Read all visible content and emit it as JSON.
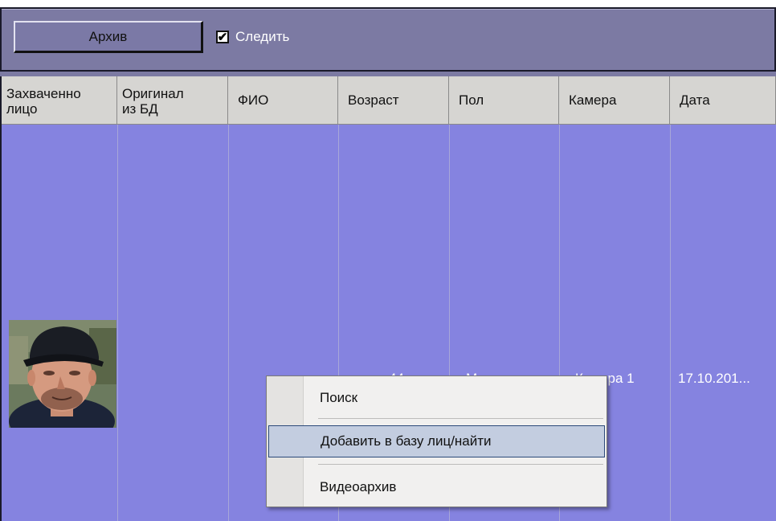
{
  "toolbar": {
    "archive_label": "Архив",
    "follow_label": "Следить",
    "follow_checked": true
  },
  "table": {
    "columns": [
      {
        "label": "Захваченно\nлицо"
      },
      {
        "label": "Оригинал\nиз БД"
      },
      {
        "label": "ФИО"
      },
      {
        "label": "Возраст"
      },
      {
        "label": "Пол"
      },
      {
        "label": "Камера"
      },
      {
        "label": "Дата"
      }
    ],
    "rows": [
      {
        "age": "44",
        "gender": "Мужчина",
        "camera": "Камера 1",
        "date": "17.10.201..."
      }
    ]
  },
  "context_menu": {
    "items": [
      {
        "label": "Поиск"
      },
      {
        "label": "Добавить в базу лиц/найти"
      },
      {
        "label": "Видеоархив"
      }
    ]
  },
  "colors": {
    "toolbar_bg": "#7c7aa3",
    "row_bg": "#8583e0",
    "header_bg": "#d6d5d2",
    "menu_bg": "#f1f0ef",
    "menu_highlight": "#c3cde0"
  }
}
